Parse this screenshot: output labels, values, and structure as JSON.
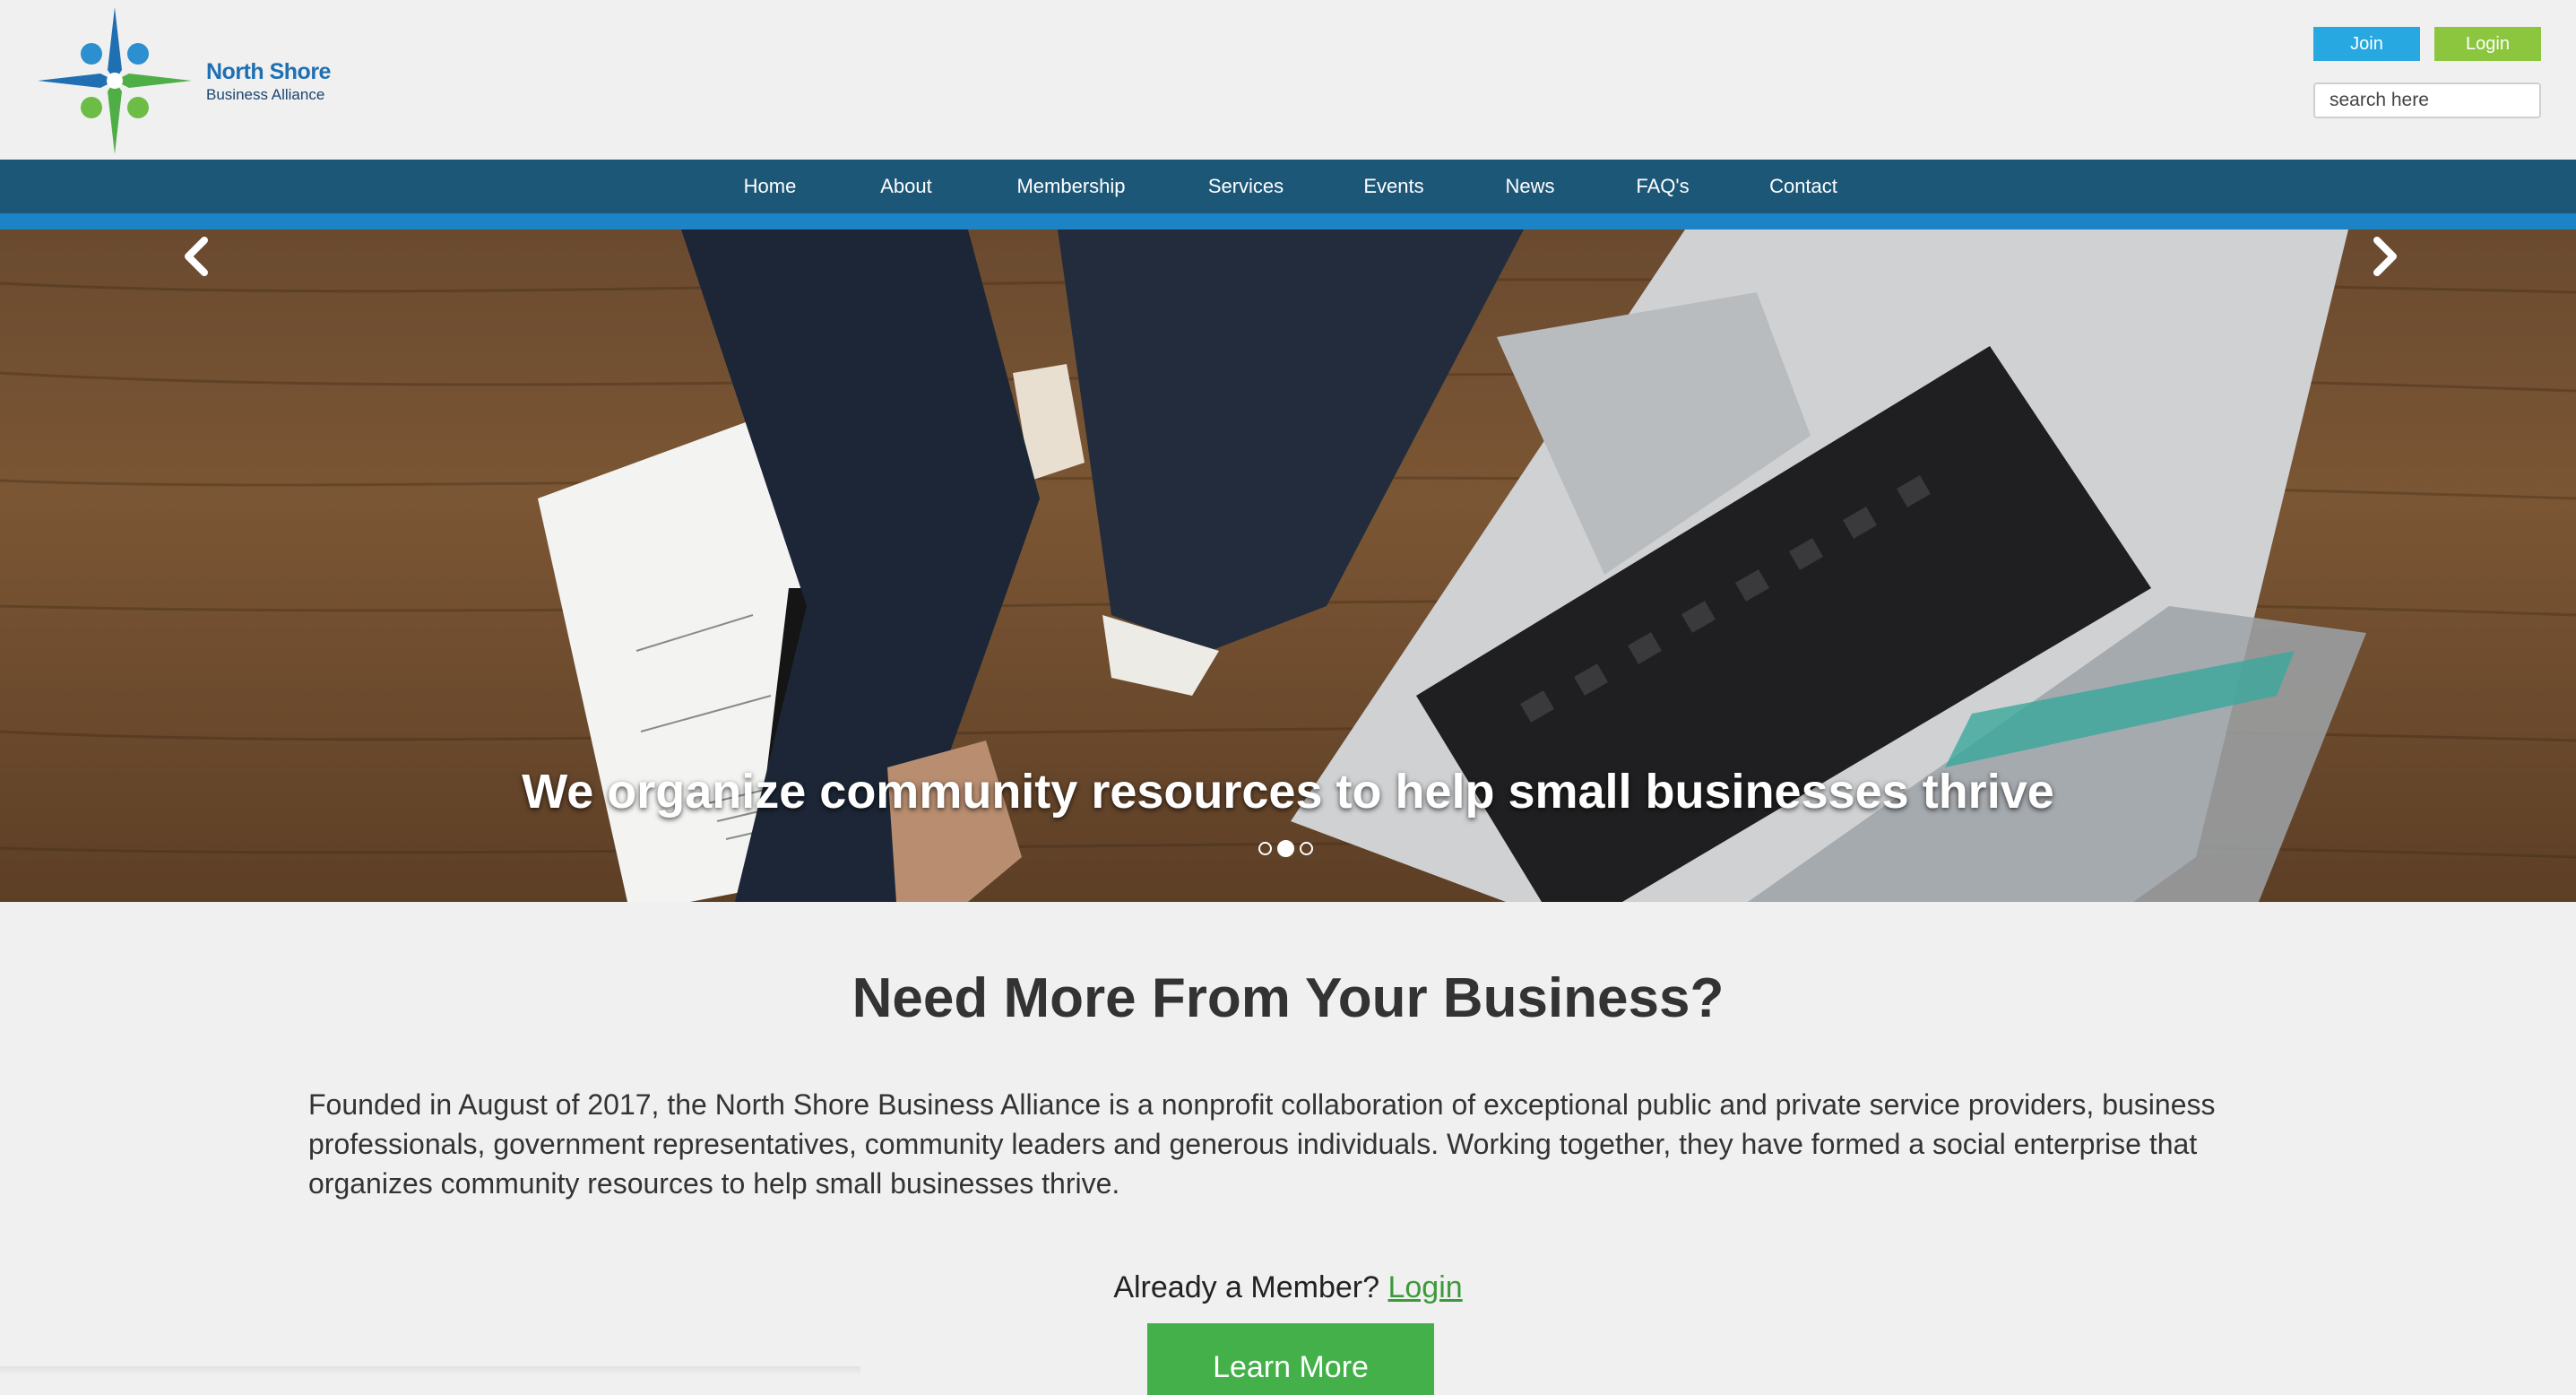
{
  "brand": {
    "name": "North Shore",
    "subtitle": "Business Alliance"
  },
  "header": {
    "join_label": "Join",
    "login_label": "Login",
    "search_placeholder": "search here"
  },
  "nav": {
    "items": [
      {
        "label": "Home",
        "active": true
      },
      {
        "label": "About"
      },
      {
        "label": "Membership"
      },
      {
        "label": "Services"
      },
      {
        "label": "Events"
      },
      {
        "label": "News"
      },
      {
        "label": "FAQ's"
      },
      {
        "label": "Contact"
      }
    ]
  },
  "hero": {
    "caption": "We organize community resources to help small businesses thrive",
    "slides_total": 3,
    "active_slide": 2,
    "prev_icon": "chevron-left-icon",
    "next_icon": "chevron-right-icon"
  },
  "main": {
    "heading": "Need More From Your Business?",
    "paragraph": "Founded in August of 2017, the North Shore Business Alliance is a nonprofit collaboration of exceptional public and private service providers, business professionals, government representatives, community leaders and generous individuals. Working together, they have formed a social enterprise that organizes community resources to help small businesses thrive.",
    "member_prompt": "Already a Member?",
    "member_login_link": "Login",
    "cta_label": "Learn More"
  },
  "colors": {
    "nav_bg": "#1d5778",
    "nav_stripe": "#1b83c6",
    "join": "#28a8e0",
    "login": "#8cc63f",
    "cta": "#43b04a"
  }
}
